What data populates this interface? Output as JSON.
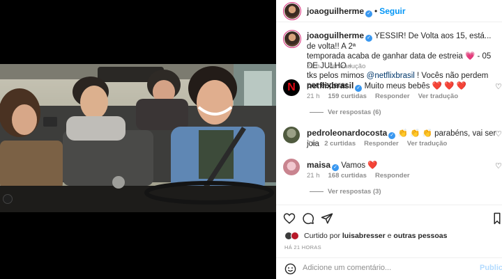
{
  "post": {
    "author": "joaoguilherme",
    "follow_label": "Seguir",
    "dot": "•"
  },
  "caption": {
    "author": "joaoguilherme",
    "text_part1": "YESSIR! De Volta aos 15, está... de volta!! A 2ª",
    "text_part2": "temporada acaba de ganhar data de estreia 💗 - 05 DE JULHO -",
    "text_part3_a": "tks pelos mimos ",
    "mention": "@netflixbrasil",
    "text_part3_b": " ! Vocês não perdem por esperar.",
    "time": "21 h",
    "see_translation": "Ver tradução"
  },
  "comments": [
    {
      "author": "netflixbrasil",
      "text": "Muito meus bebês ❤️ ❤️ ❤️",
      "time": "21 h",
      "likes": "159 curtidas",
      "reply": "Responder",
      "translate": "Ver tradução",
      "replies": "Ver respostas (6)"
    },
    {
      "author": "pedroleonardocosta",
      "text": "👏 👏 👏 parabéns, vai ser joia",
      "time": "2 h",
      "likes": "2 curtidas",
      "reply": "Responder",
      "translate": "Ver tradução"
    },
    {
      "author": "maisa",
      "text": "Vamos ❤️",
      "time": "21 h",
      "likes": "168 curtidas",
      "reply": "Responder",
      "replies": "Ver respostas (3)"
    }
  ],
  "likes_line": {
    "prefix": "Curtido por ",
    "user": "luisabresser",
    "suffix": " e ",
    "others": "outras pessoas"
  },
  "post_time": "HÁ 21 HORAS",
  "add_comment": {
    "placeholder": "Adicione um comentário...",
    "publish": "Publica"
  },
  "colors": {
    "accent": "#0095f6",
    "verified": "#3897f0",
    "like_red": "#ed4956"
  }
}
